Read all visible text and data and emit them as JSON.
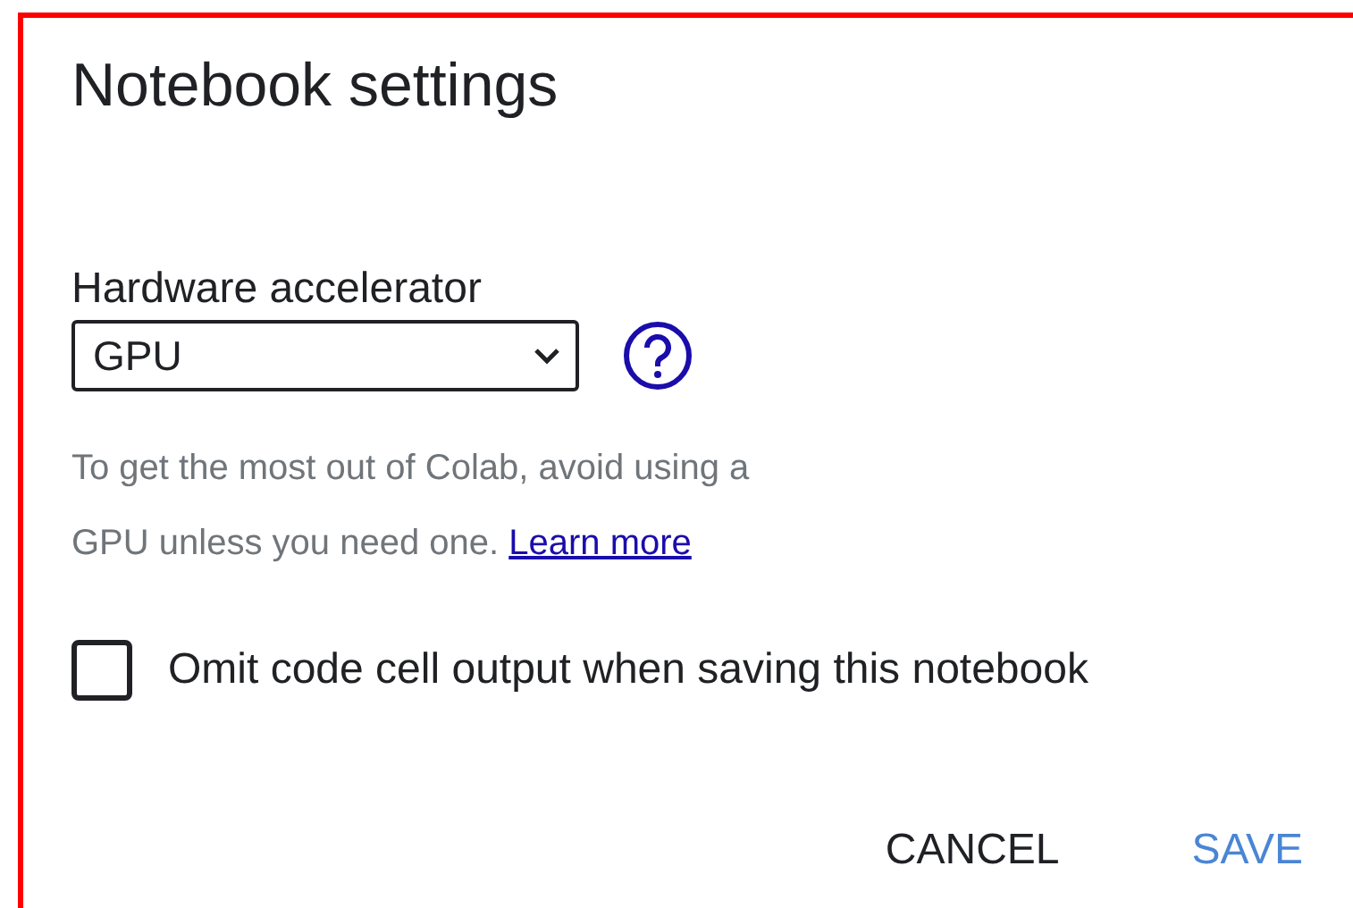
{
  "dialog": {
    "title": "Notebook settings",
    "hardware_accelerator": {
      "label": "Hardware accelerator",
      "value": "GPU"
    },
    "help_text": "To get the most out of Colab, avoid using a GPU unless you need one.",
    "learn_more_link": "Learn more",
    "omit_output": {
      "label": "Omit code cell output when saving this notebook",
      "checked": false
    },
    "buttons": [
      {
        "label": "CANCEL",
        "kind": "text"
      },
      {
        "label": "SAVE",
        "kind": "primary"
      }
    ]
  }
}
